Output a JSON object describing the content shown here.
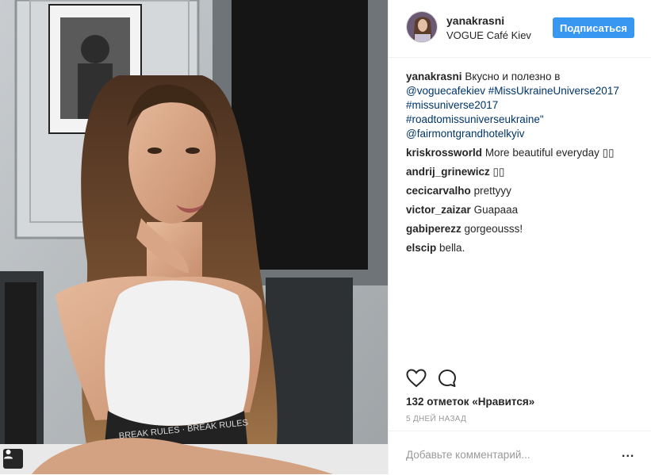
{
  "header": {
    "username": "yanakrasni",
    "location": "VOGUE Café Kiev",
    "follow_label": "Подписаться"
  },
  "caption": {
    "username": "yanakrasni",
    "lines": [
      "Вкусно и полезно в",
      "@voguecafekiev #MissUkraineUniverse2017",
      "#missuniverse2017",
      "#roadtomissuniverseukraine\"",
      "@fairmontgrandhotelkyiv"
    ]
  },
  "comments": [
    {
      "user": "kriskrossworld",
      "text": "More beautiful everyday ▯▯"
    },
    {
      "user": "andrij_grinewicz",
      "text": "▯▯"
    },
    {
      "user": "cecicarvalho",
      "text": "prettyyy"
    },
    {
      "user": "victor_zaizar",
      "text": "Guapaaa"
    },
    {
      "user": "gabiperezz",
      "text": "gorgeousss!"
    },
    {
      "user": "elscip",
      "text": "bella."
    }
  ],
  "likes_text": "132 отметок «Нравится»",
  "timestamp": "5 ДНЕЙ НАЗАД",
  "add_comment_placeholder": "Добавьте комментарий...",
  "more_label": "...",
  "icons": {
    "like": "heart-icon",
    "comment": "comment-icon",
    "tag": "user-tag-icon",
    "more": "more-options-icon"
  },
  "colors": {
    "accent": "#3897f0",
    "link": "#003569",
    "text": "#262626",
    "muted": "#999999"
  }
}
